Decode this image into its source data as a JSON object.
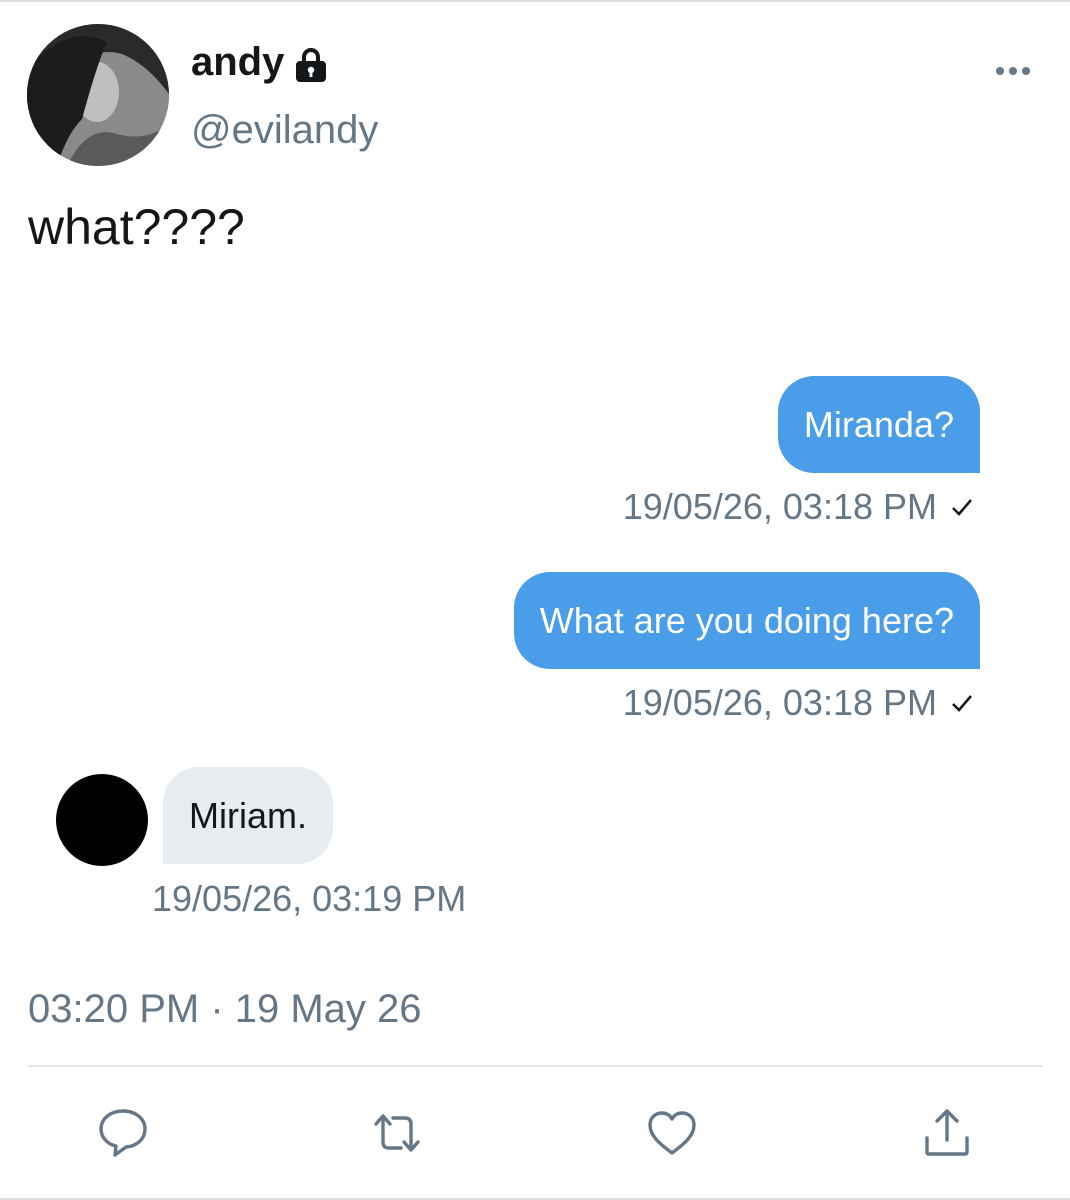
{
  "tweet": {
    "author": {
      "name": "andy",
      "handle": "@evilandy",
      "protected_icon": "lock-icon"
    },
    "more_icon": "ellipsis-icon",
    "text": "what????",
    "timestamp": "03:20 PM · 19 May 26"
  },
  "dm": {
    "messages": [
      {
        "direction": "outgoing",
        "text": "Miranda?",
        "time": "19/05/26, 03:18 PM",
        "status_icon": "check-icon"
      },
      {
        "direction": "outgoing",
        "text": "What are you doing here?",
        "time": "19/05/26, 03:18 PM",
        "status_icon": "check-icon"
      },
      {
        "direction": "incoming",
        "text": "Miriam.",
        "time": "19/05/26, 03:19 PM"
      }
    ]
  },
  "actions": [
    "reply-icon",
    "retweet-icon",
    "like-icon",
    "share-icon"
  ],
  "colors": {
    "outgoing_bubble": "#4a9de8",
    "incoming_bubble": "#e6ecf0",
    "secondary_text": "#657786",
    "primary_text": "#14171a"
  }
}
